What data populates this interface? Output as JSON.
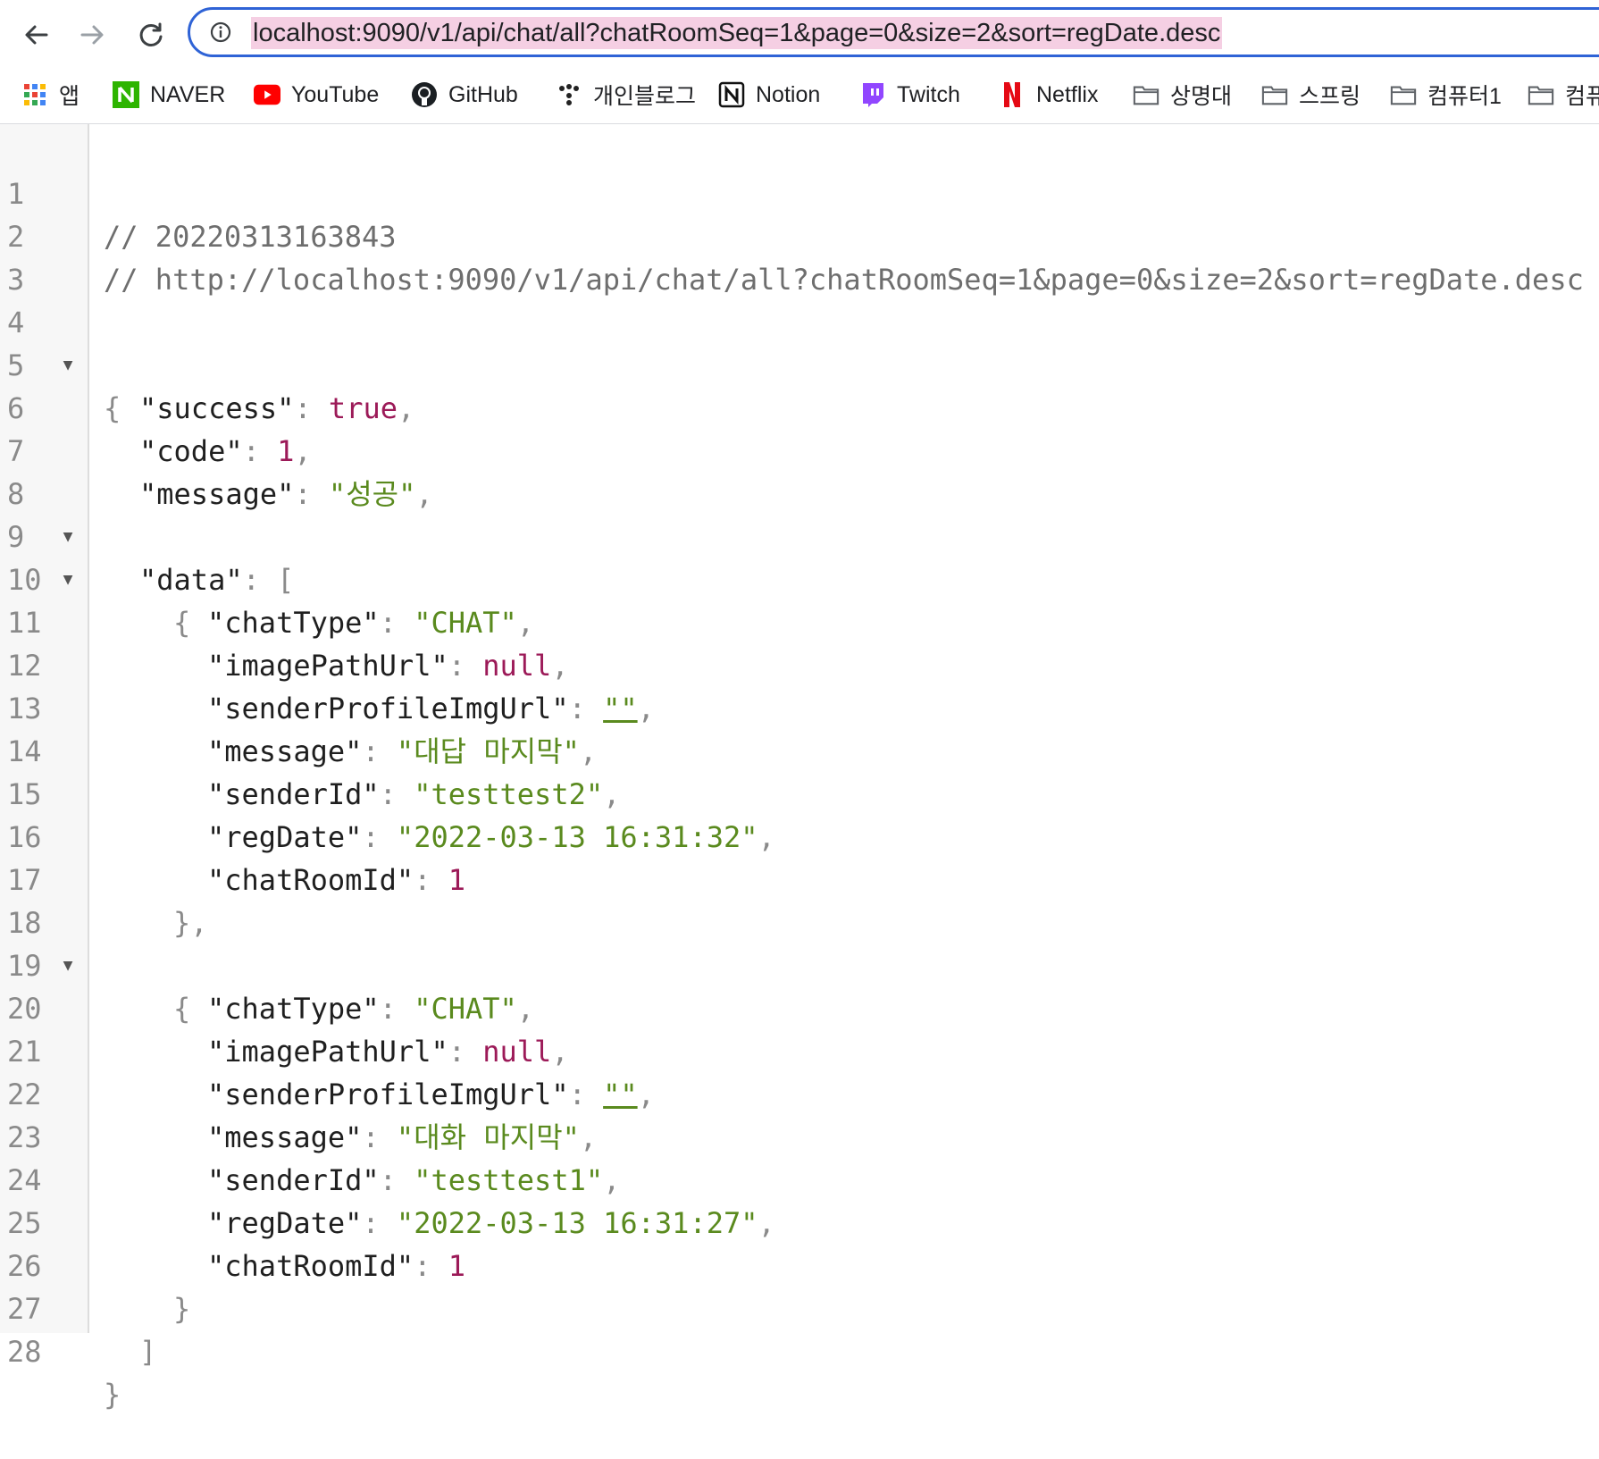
{
  "browser": {
    "url": "localhost:9090/v1/api/chat/all?chatRoomSeq=1&page=0&size=2&sort=regDate.desc",
    "nav_icons": [
      "back-arrow-icon",
      "forward-arrow-icon",
      "reload-icon",
      "info-icon"
    ]
  },
  "bookmarks": [
    {
      "label": "앱",
      "icon": "apps-grid-icon"
    },
    {
      "label": "NAVER",
      "icon": "naver-icon"
    },
    {
      "label": "YouTube",
      "icon": "youtube-icon"
    },
    {
      "label": "GitHub",
      "icon": "github-icon"
    },
    {
      "label": "개인블로그",
      "icon": "dots-icon"
    },
    {
      "label": "Notion",
      "icon": "notion-icon"
    },
    {
      "label": "Twitch",
      "icon": "twitch-icon"
    },
    {
      "label": "Netflix",
      "icon": "netflix-icon"
    },
    {
      "label": "상명대",
      "icon": "folder-icon"
    },
    {
      "label": "스프링",
      "icon": "folder-icon"
    },
    {
      "label": "컴퓨터1",
      "icon": "folder-icon"
    },
    {
      "label": "컴퓨",
      "icon": "folder-icon"
    }
  ],
  "json_view": {
    "comment_timestamp": "// 20220313163843",
    "comment_url": "// http://localhost:9090/v1/api/chat/all?chatRoomSeq=1&page=0&size=2&sort=regDate.desc",
    "line_numbers": [
      "1",
      "2",
      "3",
      "4",
      "5",
      "6",
      "7",
      "8",
      "9",
      "10",
      "11",
      "12",
      "13",
      "14",
      "15",
      "16",
      "17",
      "18",
      "19",
      "20",
      "21",
      "22",
      "23",
      "24",
      "25",
      "26",
      "27",
      "28"
    ],
    "success": "true",
    "code": "1",
    "message": "\"성공\"",
    "records": [
      {
        "chatType": "\"CHAT\"",
        "imagePathUrl": "null",
        "senderProfileImgUrl": "\"\"",
        "message": "\"대답 마지막\"",
        "senderId": "\"testtest2\"",
        "regDate": "\"2022-03-13 16:31:32\"",
        "chatRoomId": "1"
      },
      {
        "chatType": "\"CHAT\"",
        "imagePathUrl": "null",
        "senderProfileImgUrl": "\"\"",
        "message": "\"대화 마지막\"",
        "senderId": "\"testtest1\"",
        "regDate": "\"2022-03-13 16:31:27\"",
        "chatRoomId": "1"
      }
    ]
  },
  "colors": {
    "string": "#5a8a1e",
    "literal": "#9c1a58",
    "url_highlight": "#f5cfe3",
    "omnibox_border": "#2f63d6"
  }
}
